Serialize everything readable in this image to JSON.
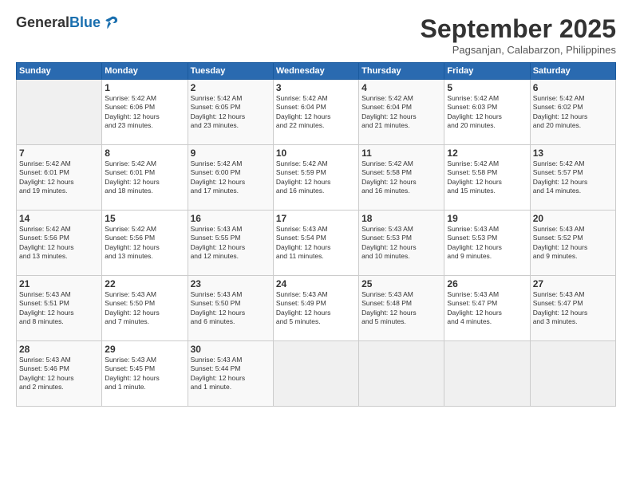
{
  "header": {
    "logo_general": "General",
    "logo_blue": "Blue",
    "month_title": "September 2025",
    "location": "Pagsanjan, Calabarzon, Philippines"
  },
  "days_of_week": [
    "Sunday",
    "Monday",
    "Tuesday",
    "Wednesday",
    "Thursday",
    "Friday",
    "Saturday"
  ],
  "weeks": [
    [
      {
        "day": "",
        "info": ""
      },
      {
        "day": "1",
        "info": "Sunrise: 5:42 AM\nSunset: 6:06 PM\nDaylight: 12 hours\nand 23 minutes."
      },
      {
        "day": "2",
        "info": "Sunrise: 5:42 AM\nSunset: 6:05 PM\nDaylight: 12 hours\nand 23 minutes."
      },
      {
        "day": "3",
        "info": "Sunrise: 5:42 AM\nSunset: 6:04 PM\nDaylight: 12 hours\nand 22 minutes."
      },
      {
        "day": "4",
        "info": "Sunrise: 5:42 AM\nSunset: 6:04 PM\nDaylight: 12 hours\nand 21 minutes."
      },
      {
        "day": "5",
        "info": "Sunrise: 5:42 AM\nSunset: 6:03 PM\nDaylight: 12 hours\nand 20 minutes."
      },
      {
        "day": "6",
        "info": "Sunrise: 5:42 AM\nSunset: 6:02 PM\nDaylight: 12 hours\nand 20 minutes."
      }
    ],
    [
      {
        "day": "7",
        "info": "Sunrise: 5:42 AM\nSunset: 6:01 PM\nDaylight: 12 hours\nand 19 minutes."
      },
      {
        "day": "8",
        "info": "Sunrise: 5:42 AM\nSunset: 6:01 PM\nDaylight: 12 hours\nand 18 minutes."
      },
      {
        "day": "9",
        "info": "Sunrise: 5:42 AM\nSunset: 6:00 PM\nDaylight: 12 hours\nand 17 minutes."
      },
      {
        "day": "10",
        "info": "Sunrise: 5:42 AM\nSunset: 5:59 PM\nDaylight: 12 hours\nand 16 minutes."
      },
      {
        "day": "11",
        "info": "Sunrise: 5:42 AM\nSunset: 5:58 PM\nDaylight: 12 hours\nand 16 minutes."
      },
      {
        "day": "12",
        "info": "Sunrise: 5:42 AM\nSunset: 5:58 PM\nDaylight: 12 hours\nand 15 minutes."
      },
      {
        "day": "13",
        "info": "Sunrise: 5:42 AM\nSunset: 5:57 PM\nDaylight: 12 hours\nand 14 minutes."
      }
    ],
    [
      {
        "day": "14",
        "info": "Sunrise: 5:42 AM\nSunset: 5:56 PM\nDaylight: 12 hours\nand 13 minutes."
      },
      {
        "day": "15",
        "info": "Sunrise: 5:42 AM\nSunset: 5:56 PM\nDaylight: 12 hours\nand 13 minutes."
      },
      {
        "day": "16",
        "info": "Sunrise: 5:43 AM\nSunset: 5:55 PM\nDaylight: 12 hours\nand 12 minutes."
      },
      {
        "day": "17",
        "info": "Sunrise: 5:43 AM\nSunset: 5:54 PM\nDaylight: 12 hours\nand 11 minutes."
      },
      {
        "day": "18",
        "info": "Sunrise: 5:43 AM\nSunset: 5:53 PM\nDaylight: 12 hours\nand 10 minutes."
      },
      {
        "day": "19",
        "info": "Sunrise: 5:43 AM\nSunset: 5:53 PM\nDaylight: 12 hours\nand 9 minutes."
      },
      {
        "day": "20",
        "info": "Sunrise: 5:43 AM\nSunset: 5:52 PM\nDaylight: 12 hours\nand 9 minutes."
      }
    ],
    [
      {
        "day": "21",
        "info": "Sunrise: 5:43 AM\nSunset: 5:51 PM\nDaylight: 12 hours\nand 8 minutes."
      },
      {
        "day": "22",
        "info": "Sunrise: 5:43 AM\nSunset: 5:50 PM\nDaylight: 12 hours\nand 7 minutes."
      },
      {
        "day": "23",
        "info": "Sunrise: 5:43 AM\nSunset: 5:50 PM\nDaylight: 12 hours\nand 6 minutes."
      },
      {
        "day": "24",
        "info": "Sunrise: 5:43 AM\nSunset: 5:49 PM\nDaylight: 12 hours\nand 5 minutes."
      },
      {
        "day": "25",
        "info": "Sunrise: 5:43 AM\nSunset: 5:48 PM\nDaylight: 12 hours\nand 5 minutes."
      },
      {
        "day": "26",
        "info": "Sunrise: 5:43 AM\nSunset: 5:47 PM\nDaylight: 12 hours\nand 4 minutes."
      },
      {
        "day": "27",
        "info": "Sunrise: 5:43 AM\nSunset: 5:47 PM\nDaylight: 12 hours\nand 3 minutes."
      }
    ],
    [
      {
        "day": "28",
        "info": "Sunrise: 5:43 AM\nSunset: 5:46 PM\nDaylight: 12 hours\nand 2 minutes."
      },
      {
        "day": "29",
        "info": "Sunrise: 5:43 AM\nSunset: 5:45 PM\nDaylight: 12 hours\nand 1 minute."
      },
      {
        "day": "30",
        "info": "Sunrise: 5:43 AM\nSunset: 5:44 PM\nDaylight: 12 hours\nand 1 minute."
      },
      {
        "day": "",
        "info": ""
      },
      {
        "day": "",
        "info": ""
      },
      {
        "day": "",
        "info": ""
      },
      {
        "day": "",
        "info": ""
      }
    ]
  ]
}
